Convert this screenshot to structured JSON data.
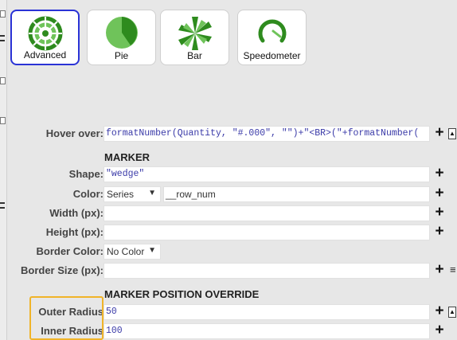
{
  "chart_types": [
    {
      "label": "Advanced",
      "icon": "advanced-chart-icon",
      "selected": true
    },
    {
      "label": "Pie",
      "icon": "pie-chart-icon",
      "selected": false
    },
    {
      "label": "Bar",
      "icon": "bar-chart-icon",
      "selected": false
    },
    {
      "label": "Speedometer",
      "icon": "speedometer-icon",
      "selected": false
    }
  ],
  "hover_over": {
    "label": "Hover over:",
    "value": "formatNumber(Quantity, \"#.000\", \"\")+\"<BR>(\"+formatNumber("
  },
  "marker": {
    "section_title": "MARKER",
    "shape_label": "Shape:",
    "shape_value": "\"wedge\"",
    "color_label": "Color:",
    "color_mode": "Series",
    "color_value": "__row_num",
    "width_label": "Width (px):",
    "width_value": "",
    "height_label": "Height (px):",
    "height_value": "",
    "border_color_label": "Border Color:",
    "border_color_value": "No Color",
    "border_size_label": "Border Size (px):",
    "border_size_value": ""
  },
  "marker_position_override": {
    "section_title": "MARKER POSITION OVERRIDE",
    "outer_radius_label": "Outer Radius",
    "outer_radius_value": "50",
    "inner_radius_label": "Inner Radius",
    "inner_radius_value": "100"
  },
  "colors": {
    "chart_green": "#2e8b1e",
    "selected_border": "#2a33d6",
    "highlight": "#f0b429",
    "field_text": "#3a3aa8"
  }
}
